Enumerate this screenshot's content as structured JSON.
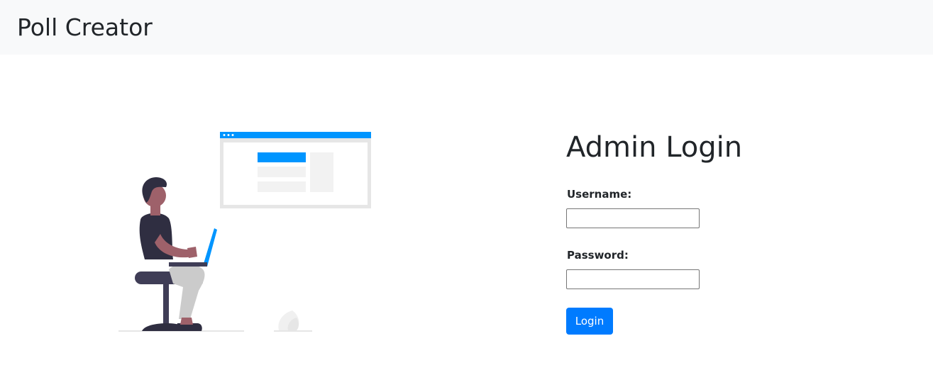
{
  "navbar": {
    "brand": "Poll Creator"
  },
  "illustration": {
    "icon": "person-with-laptop-illustration"
  },
  "login": {
    "title": "Admin Login",
    "username_label": "Username:",
    "username_value": "",
    "username_placeholder": "",
    "password_label": "Password:",
    "password_value": "",
    "password_placeholder": "",
    "submit_label": "Login"
  },
  "colors": {
    "accent": "#007bff",
    "navbar_bg": "#f8f9fa",
    "text": "#212529",
    "illustration_blue": "#0095ff",
    "illustration_dark": "#2f2e41"
  }
}
